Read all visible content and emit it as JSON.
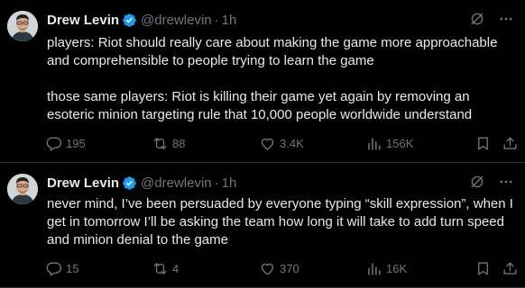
{
  "colors": {
    "background": "#000000",
    "text": "#e7e9ea",
    "secondary": "#71767b",
    "verified": "#1d9bf0",
    "divider": "#2f3336"
  },
  "tweets": [
    {
      "author": "Drew Levin",
      "handle": "@drewlevin",
      "separator": "·",
      "time": "1h",
      "text": "players: Riot should really care about making the game more approachable and comprehensible to people trying to learn the game\n\nthose same players: Riot is killing their game yet again by removing an esoteric minion targeting rule that 10,000 people worldwide understand",
      "replies": "195",
      "reposts": "88",
      "likes": "3.4K",
      "views": "156K"
    },
    {
      "author": "Drew Levin",
      "handle": "@drewlevin",
      "separator": "·",
      "time": "1h",
      "text": "never mind, I’ve been persuaded by everyone typing “skill expression”, when I get in tomorrow I’ll be asking the team how long it will take to add turn speed and minion denial to the game",
      "replies": "15",
      "reposts": "4",
      "likes": "370",
      "views": "16K"
    }
  ]
}
